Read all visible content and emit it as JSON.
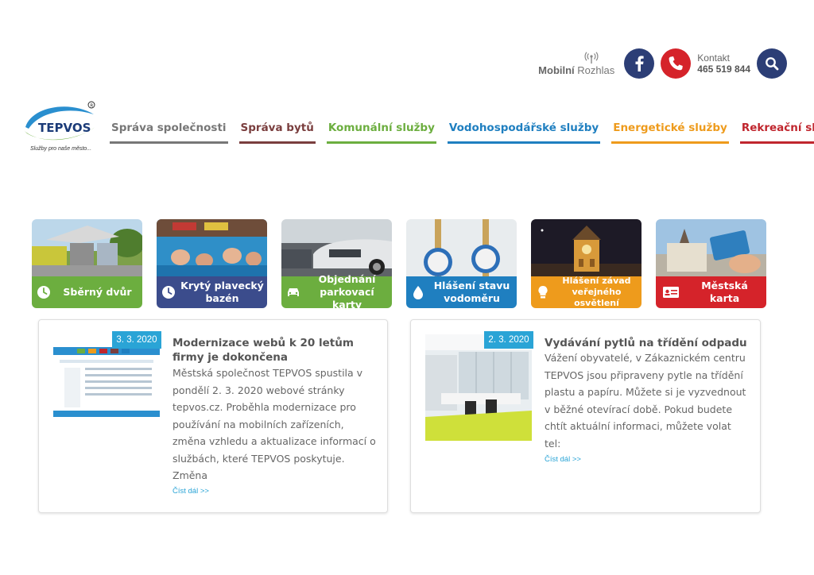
{
  "header": {
    "radio": {
      "bold": "Mobilní",
      "normal": "Rozhlas"
    },
    "contact": {
      "label": "Kontakt",
      "phone": "465 519 844"
    },
    "logo": {
      "text": "TEPVOS",
      "slogan": "Služby pro naše město..."
    }
  },
  "colors": {
    "sprava_spolecnosti": "#777777",
    "sprava_bytu": "#7a3e3e",
    "komunalni": "#6cae3f",
    "vodohospodarske": "#1f7fc0",
    "energeticke": "#ee9b1c",
    "rekreacni": "#c0262e",
    "badge": "#2aa4d6",
    "navy": "#2c3e76"
  },
  "nav": [
    {
      "label": "Správa společnosti",
      "color": "#777777"
    },
    {
      "label": "Správa bytů",
      "color": "#7a3e3e"
    },
    {
      "label": "Komunální služby",
      "color": "#6cae3f"
    },
    {
      "label": "Vodohospodářské služby",
      "color": "#1f7fc0"
    },
    {
      "label": "Energetické služby",
      "color": "#ee9b1c"
    },
    {
      "label": "Rekreační služby",
      "color": "#c0262e"
    }
  ],
  "tiles": [
    {
      "label": "Sběrný dvůr",
      "icon": "clock-icon",
      "color": "#6cae3f"
    },
    {
      "label": "Krytý plavecký bazén",
      "icon": "clock-icon",
      "color": "#3b4c8c"
    },
    {
      "label": "Objednání parkovací karty",
      "icon": "car-icon",
      "color": "#6cae3f"
    },
    {
      "label": "Hlášení stavu vodoměru",
      "icon": "drop-icon",
      "color": "#1f7fc0"
    },
    {
      "label": "Hlášení závad veřejného osvětlení",
      "icon": "bulb-icon",
      "color": "#ee9b1c"
    },
    {
      "label": "Městská karta",
      "icon": "id-card-icon",
      "color": "#d5232a"
    }
  ],
  "news": [
    {
      "date": "3. 3. 2020",
      "title": "Modernizace webů k 20 letům firmy je dokončena",
      "lines": [
        "Městská společnost TEPVOS spustila v",
        "pondělí 2. 3. 2020 webové stránky",
        "tepvos.cz. Proběhla modernizace pro",
        "používání na mobilních zařízeních,",
        "změna vzhledu a aktualizace informací o",
        "službách, které TEPVOS poskytuje.",
        "Změna"
      ],
      "read_more": "Číst dál >>"
    },
    {
      "date": "2. 3. 2020",
      "title": "Vydávání pytlů na třídění odpadu",
      "lines": [
        "Vážení obyvatelé, v Zákaznickém centru",
        "TEPVOS jsou připraveny pytle na třídění",
        "plastu a papíru. Můžete si je vyzvednout",
        "v běžné otevírací době. Pokud budete",
        "chtít aktuální informaci, můžete volat",
        "tel:"
      ],
      "read_more": "Číst dál >>"
    }
  ]
}
